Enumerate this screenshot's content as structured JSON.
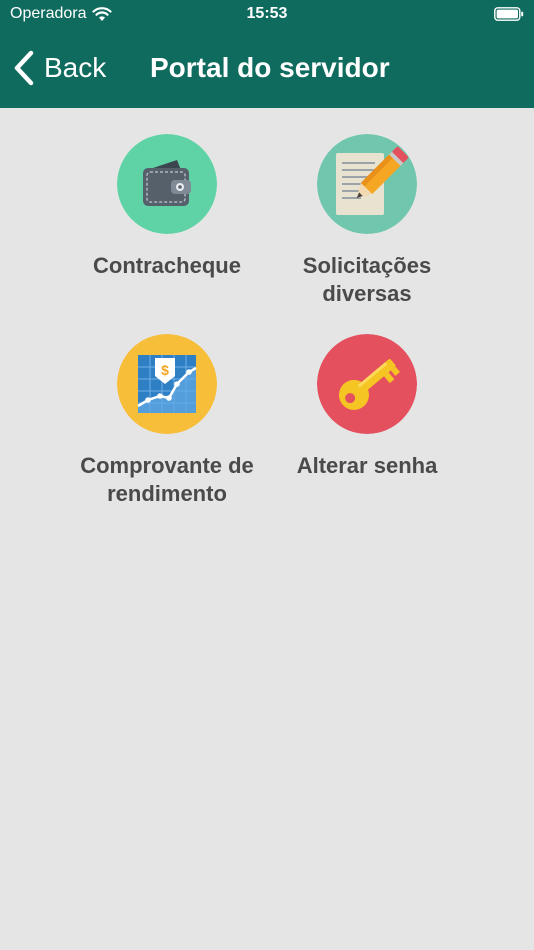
{
  "status_bar": {
    "carrier": "Operadora",
    "time": "15:53"
  },
  "nav": {
    "back_label": "Back",
    "title": "Portal do servidor"
  },
  "colors": {
    "header": "#0e6b5e",
    "background": "#e5e5e5",
    "label": "#4a4a4a",
    "wallet_bg": "#5fd3a6",
    "document_bg": "#71c6ae",
    "chart_bg": "#f7be39",
    "key_bg": "#e5505f"
  },
  "tiles": [
    {
      "label": "Contracheque",
      "icon": "wallet-icon"
    },
    {
      "label": "Solicitações diversas",
      "icon": "document-pencil-icon"
    },
    {
      "label": "Comprovante de rendimento",
      "icon": "income-chart-icon"
    },
    {
      "label": "Alterar senha",
      "icon": "key-icon"
    }
  ]
}
